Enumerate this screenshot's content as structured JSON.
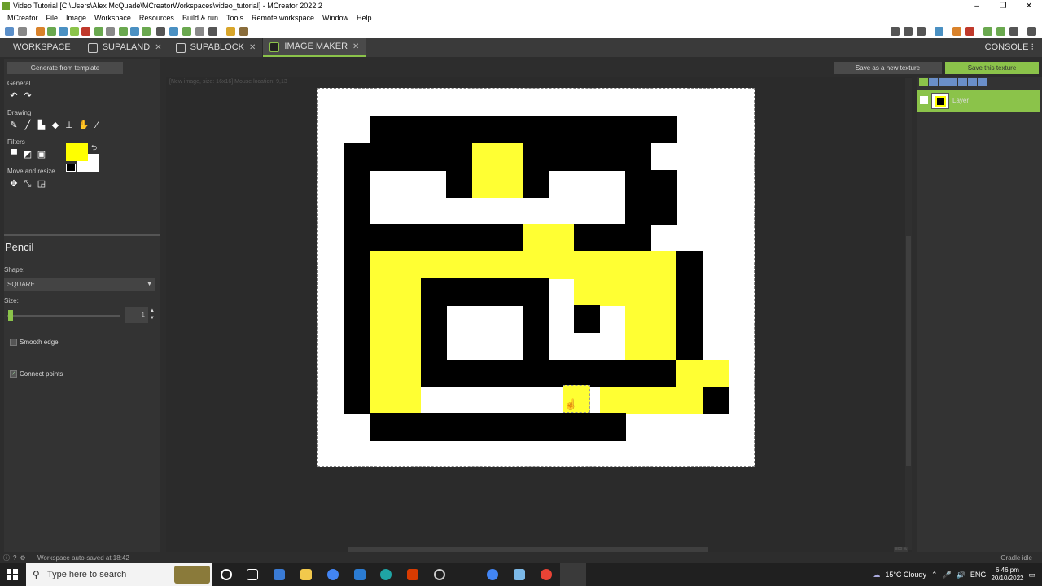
{
  "window": {
    "title": "Video Tutorial [C:\\Users\\Alex McQuade\\MCreatorWorkspaces\\video_tutorial] - MCreator 2022.2",
    "controls": [
      "–",
      "❐",
      "✕"
    ]
  },
  "menu": [
    "MCreator",
    "File",
    "Image",
    "Workspace",
    "Resources",
    "Build & run",
    "Tools",
    "Remote workspace",
    "Window",
    "Help"
  ],
  "tabs": [
    {
      "label": "WORKSPACE",
      "active": false,
      "closable": false
    },
    {
      "label": "SUPALAND",
      "active": false,
      "closable": true
    },
    {
      "label": "SUPABLOCK",
      "active": false,
      "closable": true
    },
    {
      "label": "IMAGE MAKER",
      "active": true,
      "closable": true
    }
  ],
  "console_label": "CONSOLE",
  "left": {
    "generate_button": "Generate from template",
    "sections": {
      "general": "General",
      "drawing": "Drawing",
      "filters": "Filters",
      "move": "Move and resize"
    },
    "tool_title": "Pencil",
    "shape_label": "Shape:",
    "shape_value": "SQUARE",
    "size_label": "Size:",
    "size_value": "1",
    "smooth_edge": "Smooth edge",
    "connect_points": "Connect points",
    "connect_points_checked": true,
    "smooth_edge_checked": false,
    "primary_color": "#ffff00",
    "secondary_color": "#ffffff"
  },
  "canvas": {
    "info": "[New image, size: 16x16] Mouse location: 9,13",
    "zoom": "800 %",
    "grid": [
      "................",
      "................",
      "..############..",
      ".#####YY#####...",
      ".#...#YY#...##..",
      ".#..........##..",
      ".#######YY###...",
      ".#YYYYYYYYYYYY#.",
      ".#YY#####.YYYY#.",
      ".#YY#...#.#.YY#.",
      ".#YY#...#...YY#.",
      ".#YY##########YY",
      ".#YY.......YYYY#",
      "..##########....",
      "................",
      "................"
    ]
  },
  "right": {
    "save_new_button": "Save as a new texture",
    "save_button": "Save this texture",
    "layer_name": "Layer"
  },
  "status": {
    "left": "Workspace auto-saved at 18:42",
    "right": "Gradle idle"
  },
  "taskbar": {
    "search_placeholder": "Type here to search",
    "weather": "15°C  Cloudy",
    "lang": "ENG",
    "time": "6:46 pm",
    "date": "20/10/2022"
  }
}
